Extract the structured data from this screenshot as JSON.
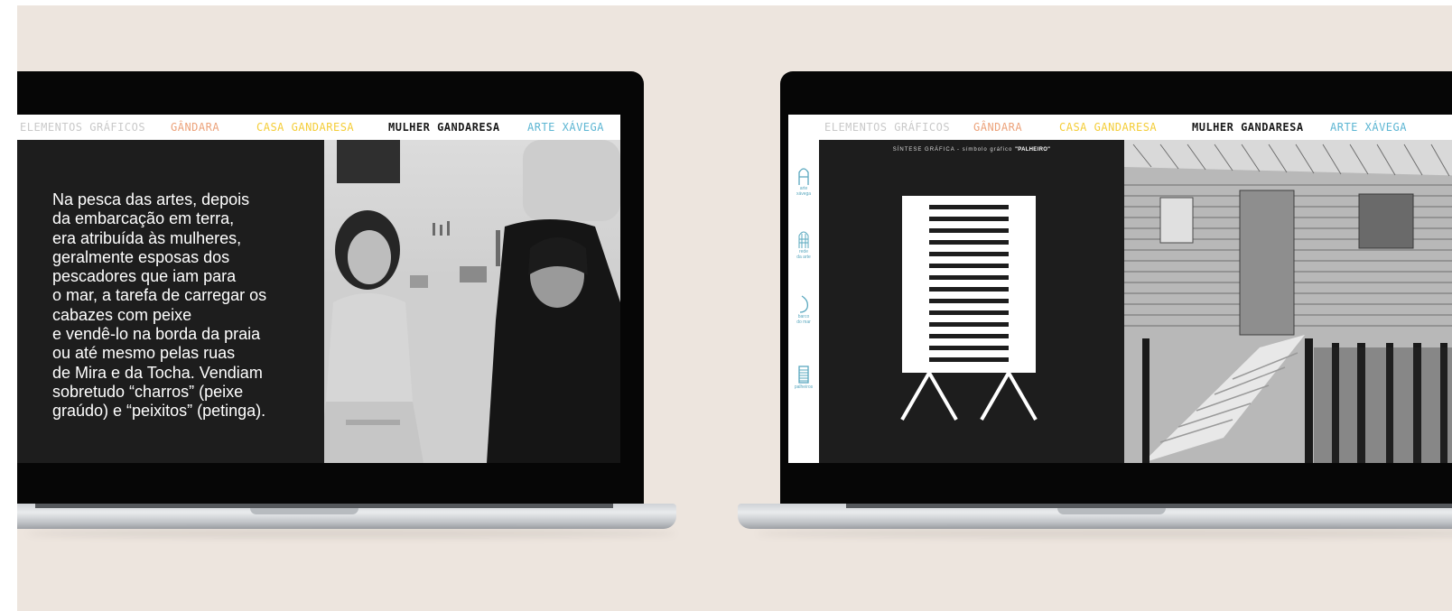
{
  "nav": {
    "items": [
      {
        "label": "ELEMENTOS GRÁFICOS",
        "color": "#c9c9c9"
      },
      {
        "label": "GÂNDARA",
        "color": "#eca27a"
      },
      {
        "label": "CASA GANDARESA",
        "color": "#f4cd38"
      },
      {
        "label": "MULHER GANDARESA",
        "color": "#1a1a1a"
      },
      {
        "label": "ARTE XÁVEGA",
        "color": "#5db6d3"
      }
    ]
  },
  "left_screen": {
    "paragraph": "Na pesca das artes, depois\nda embarcação em terra,\nera atribuída às mulheres,\ngeralmente esposas dos\npescadores que iam para\no mar, a tarefa de carregar os\ncabazes com peixe\ne vendê-lo na borda da praia\nou até mesmo pelas ruas\nde Mira e da Tocha. Vendiam\nsobretudo “charros” (peixe\ngraúdo) e “peixitos” (petinga).",
    "photo_icon": "women-carrying-baskets-photo"
  },
  "right_screen": {
    "caption_prefix": "SÍNTESE GRÁFICA - símbolo gráfico ",
    "caption_strong": "\"PALHEIRO\"",
    "sidebar": [
      {
        "icon": "arte-xavega-icon",
        "label_1": "arte",
        "label_2": "xávega"
      },
      {
        "icon": "rede-da-arte-icon",
        "label_1": "rede",
        "label_2": "da arte"
      },
      {
        "icon": "barco-do-mar-icon",
        "label_1": "barco",
        "label_2": "do mar"
      },
      {
        "icon": "palheiros-icon",
        "label_1": "palheiros",
        "label_2": ""
      }
    ],
    "photo_icon": "wooden-palheiro-house-photo"
  },
  "colors": {
    "background": "#ede5de",
    "panel": "#1d1d1d",
    "sidebar_accent": "#5aa8bf"
  }
}
